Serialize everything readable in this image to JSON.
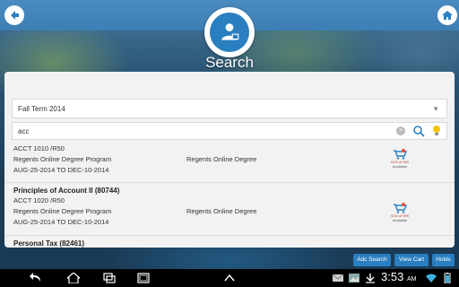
{
  "header": {
    "title": "Search",
    "back_icon": "back-arrow-icon",
    "home_icon": "home-icon"
  },
  "filters": {
    "term_value": "Fall Term 2014",
    "search_value": "acc"
  },
  "results": [
    {
      "title": "",
      "code": "ACCT 1010 /R50",
      "program": "Regents Online Degree Program",
      "college": "Regents Online Degree",
      "dates": "AUG-25-2014 TO DEC-10-2014",
      "availability": "9/15 of 999",
      "availability_label": "Available"
    },
    {
      "title": "Principles of Account II (80744)",
      "code": "ACCT 1020 /R50",
      "program": "Regents Online Degree Program",
      "college": "Regents Online Degree",
      "dates": "AUG-25-2014 TO DEC-10-2014",
      "availability": "9/15 of 999",
      "availability_label": "Available"
    },
    {
      "title": "Personal Tax (82461)"
    }
  ],
  "actions": {
    "add_search": "Adc Search",
    "view_cart": "View Cart",
    "holds": "Holds"
  },
  "status": {
    "time": "3:53",
    "ampm": "AM"
  },
  "colors": {
    "accent": "#2a7fc0",
    "topbar": "#3d7fb4"
  }
}
